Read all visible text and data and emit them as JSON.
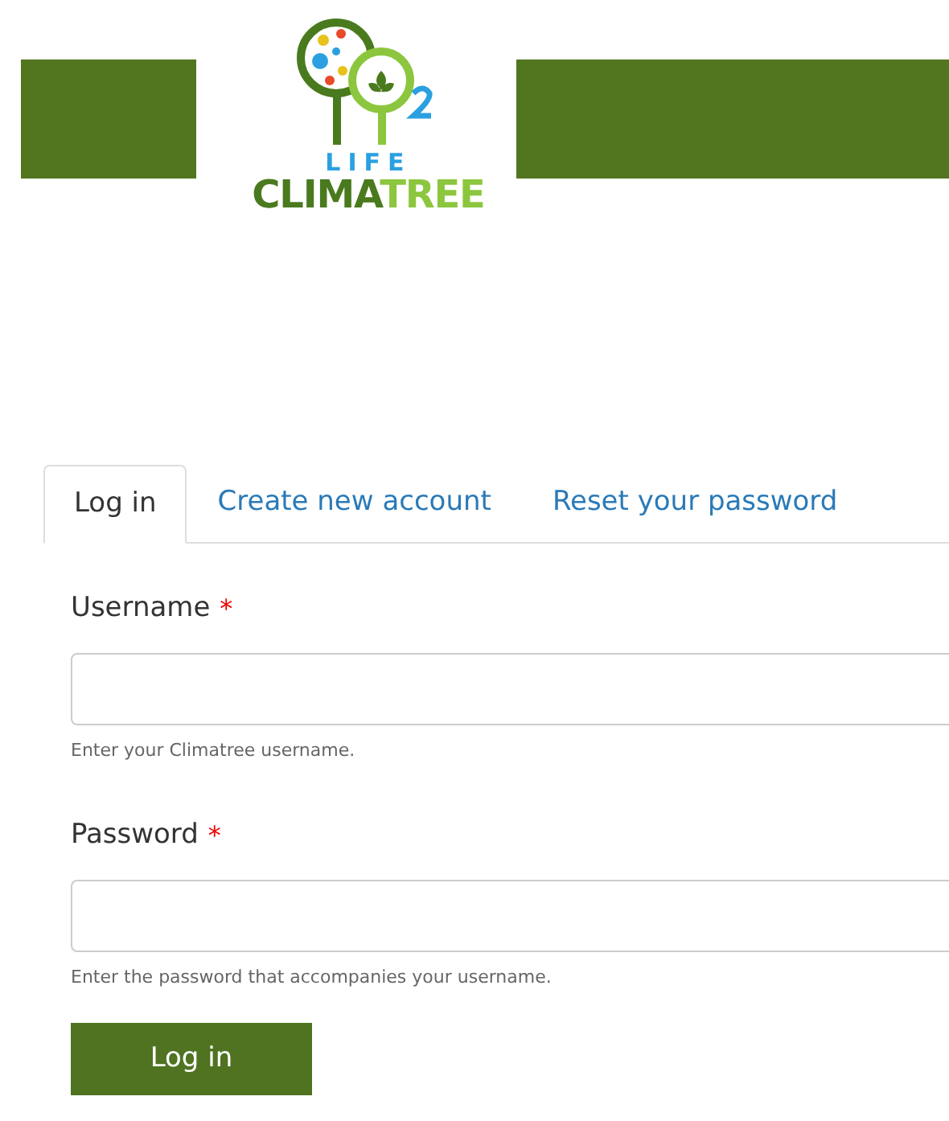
{
  "logo": {
    "line_1": "LIFE",
    "line_2_dark": "CLIMA",
    "line_2_light": "TREE"
  },
  "tabs": [
    {
      "label": "Log in",
      "selected": true
    },
    {
      "label": "Create new account",
      "selected": false
    },
    {
      "label": "Reset your password",
      "selected": false
    }
  ],
  "fields": [
    {
      "label": "Username",
      "required_mark": "*",
      "help": "Enter your Climatree username."
    },
    {
      "label": "Password",
      "required_mark": "*",
      "help": "Enter the password that accompanies your username."
    }
  ],
  "submit": "Log in"
}
